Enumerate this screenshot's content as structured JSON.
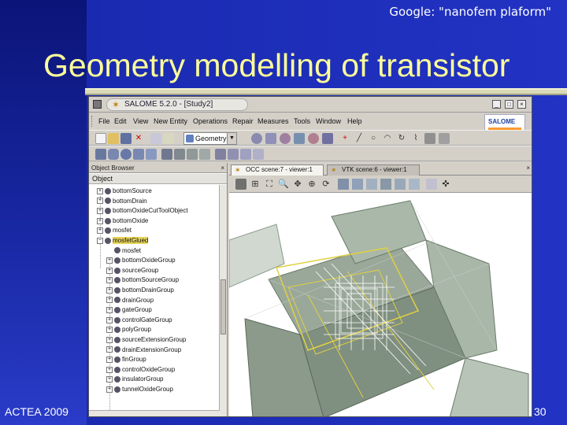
{
  "slide": {
    "top_note": "Google: \"nanofem plaform\"",
    "title": "Geometry modelling of transistor",
    "footer_left": "ACTEA 2009",
    "page_number": "30",
    "colors": {
      "background": "#1a2ab0",
      "title": "#ffff99",
      "rule": "#d9d9b8"
    }
  },
  "window": {
    "title": "SALOME 5.2.0 - [Study2]",
    "minimize": "_",
    "maximize": "□",
    "close": "×",
    "logo": "SALOME",
    "menu": [
      "File",
      "Edit",
      "View",
      "New Entity",
      "Operations",
      "Repair",
      "Measures",
      "Tools",
      "Window",
      "Help"
    ],
    "module_select": "Geometry"
  },
  "toolbar_icons": {
    "row1": [
      "new-icon",
      "open-icon",
      "save-icon",
      "close-study-icon",
      "copy-icon",
      "paste-icon"
    ],
    "row2": [
      "point-icon",
      "line-icon",
      "circle-icon",
      "arc-icon",
      "box-icon",
      "cylinder-icon",
      "sphere-icon",
      "cone-icon"
    ]
  },
  "browser": {
    "header": "Object Browser",
    "close": "×",
    "column": "Object",
    "items": [
      {
        "label": "bottomSource",
        "level": 1,
        "expand": "+"
      },
      {
        "label": "bottomDrain",
        "level": 1,
        "expand": "+"
      },
      {
        "label": "bottomOxideCutToolObject",
        "level": 1,
        "expand": "+"
      },
      {
        "label": "bottomOxide",
        "level": 1,
        "expand": "+"
      },
      {
        "label": "mosfet",
        "level": 1,
        "expand": "+"
      },
      {
        "label": "mosfetGlued",
        "level": 1,
        "expand": "−",
        "selected": true
      },
      {
        "label": "mosfet",
        "level": 2,
        "expand": ""
      },
      {
        "label": "bottomOxideGroup",
        "level": 2,
        "expand": "+"
      },
      {
        "label": "sourceGroup",
        "level": 2,
        "expand": "+"
      },
      {
        "label": "bottomSourceGroup",
        "level": 2,
        "expand": "+"
      },
      {
        "label": "bottomDrainGroup",
        "level": 2,
        "expand": "+"
      },
      {
        "label": "drainGroup",
        "level": 2,
        "expand": "+"
      },
      {
        "label": "gateGroup",
        "level": 2,
        "expand": "+"
      },
      {
        "label": "controlGateGroup",
        "level": 2,
        "expand": "+"
      },
      {
        "label": "polyGroup",
        "level": 2,
        "expand": "+"
      },
      {
        "label": "sourceExtensionGroup",
        "level": 2,
        "expand": "+"
      },
      {
        "label": "drainExtensionGroup",
        "level": 2,
        "expand": "+"
      },
      {
        "label": "finGroup",
        "level": 2,
        "expand": "+"
      },
      {
        "label": "controlOxideGroup",
        "level": 2,
        "expand": "+"
      },
      {
        "label": "insulatorGroup",
        "level": 2,
        "expand": "+"
      },
      {
        "label": "tunnelOxideGroup",
        "level": 2,
        "expand": "+"
      }
    ]
  },
  "viewer": {
    "tabs": [
      "OCC scene:7 - viewer:1",
      "VTK scene:6 - viewer:1"
    ],
    "close": "×"
  }
}
